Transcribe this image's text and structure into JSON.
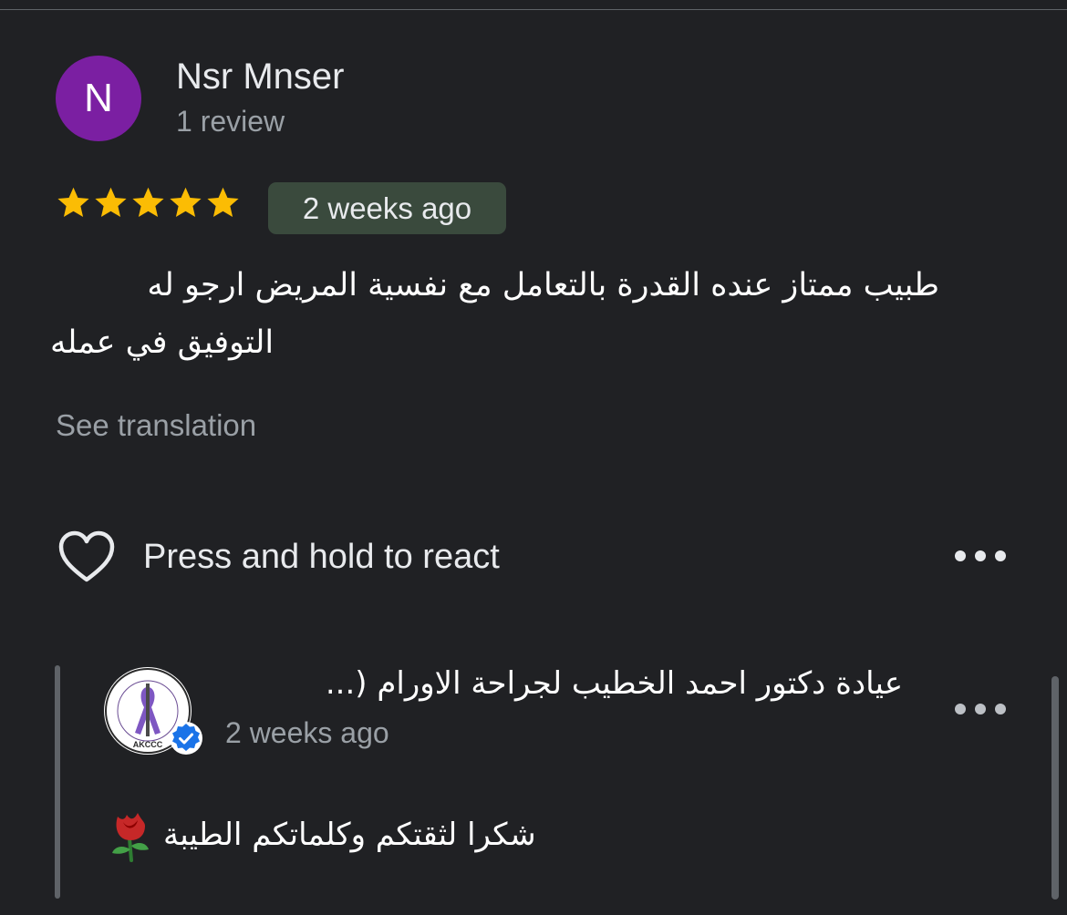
{
  "review": {
    "reviewer": {
      "avatar_letter": "N",
      "avatar_color": "#7b1fa2",
      "name": "Nsr Mnser",
      "review_count": "1 review"
    },
    "rating": 5,
    "rating_max": 5,
    "date": "2 weeks ago",
    "text_line1": "طبيب ممتاز عنده القدرة بالتعامل مع نفسية المريض ارجو له",
    "text_line2": "التوفيق في عمله",
    "see_translation": "See translation",
    "react_label": "Press and hold to react",
    "icons": {
      "react": "heart-outline-icon",
      "more": "more-horizontal-icon",
      "star": "star-icon"
    },
    "colors": {
      "star": "#fbbc04",
      "date_chip_bg": "#3a4a3d"
    }
  },
  "owner_reply": {
    "owner_name": "عيادة دكتور احمد الخطيب لجراحة الاورام (...",
    "logo_text": "AKCCC",
    "verified": true,
    "date": "2 weeks ago",
    "text": "شكرا لثقتكم وكلماتكم الطيبة",
    "icons": {
      "verified": "verified-check-icon",
      "emoji": "rose-emoji-icon",
      "more": "more-horizontal-icon"
    },
    "colors": {
      "verified": "#1a73e8"
    }
  }
}
